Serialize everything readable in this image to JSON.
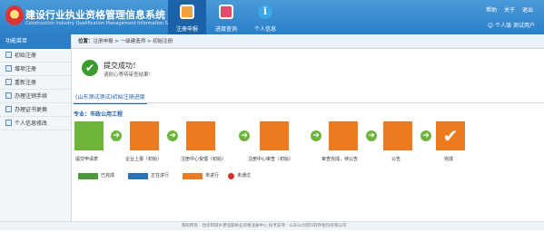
{
  "header": {
    "title": "建设行业执业资格管理信息系统",
    "subtitle": "Construction Industry Qualification Management Information System",
    "tabs": [
      {
        "label": "注册申报",
        "icon": "document-icon",
        "active": true
      },
      {
        "label": "进度查询",
        "icon": "monitor-icon",
        "active": false
      },
      {
        "label": "个人信息",
        "icon": "info-icon",
        "active": false
      }
    ],
    "links": {
      "help": "帮助",
      "about": "关于",
      "logout": "退出"
    },
    "user": "个人版  测试用户"
  },
  "sidebar": {
    "title": "功能菜单",
    "items": [
      {
        "label": "初始注册"
      },
      {
        "label": "增项注册"
      },
      {
        "label": "重新注册"
      },
      {
        "label": "办理注销手续"
      },
      {
        "label": "办理证书更换"
      },
      {
        "label": "个人信息修改"
      }
    ]
  },
  "breadcrumb": {
    "label": "位置：",
    "path": "注册申报 > 一级建造师 > 初始注册"
  },
  "success": {
    "title": "提交成功！",
    "message": "请耐心等待审查结果！"
  },
  "section_tab": "(山东测试测试)初始注册进度",
  "specialty": "专业：市政公用工程",
  "steps": [
    {
      "label": "提交申请表",
      "icon": "document-arrow-icon",
      "status": "done"
    },
    {
      "label": "企业上报（初始）",
      "icon": "folder-upload-icon",
      "status": "pending"
    },
    {
      "label": "注册中心受理（初始）",
      "icon": "gear-search-icon",
      "status": "pending"
    },
    {
      "label": "注册中心审查（初始）",
      "icon": "gear-review-icon",
      "status": "pending"
    },
    {
      "label": "审查完成，待公告",
      "icon": "printer-icon",
      "status": "pending"
    },
    {
      "label": "公告",
      "icon": "folder-icon",
      "status": "pending"
    },
    {
      "label": "完成",
      "icon": "check-icon",
      "status": "pending"
    }
  ],
  "legend": [
    {
      "label": "已完成",
      "color": "#4a9a3a"
    },
    {
      "label": "正在进行",
      "color": "#2a72b8"
    },
    {
      "label": "未进行",
      "color": "#ee7a1f"
    },
    {
      "label": "未通过",
      "color": "#d93025"
    }
  ],
  "footer": "版权所有：住房和城乡建设部执业资格注册中心    技术支持：山东山大鸥玛软件股份有限公司",
  "colors": {
    "header_blue": "#2a7fc8",
    "done_green": "#6fb43a",
    "pending_orange": "#ee7a1f"
  }
}
